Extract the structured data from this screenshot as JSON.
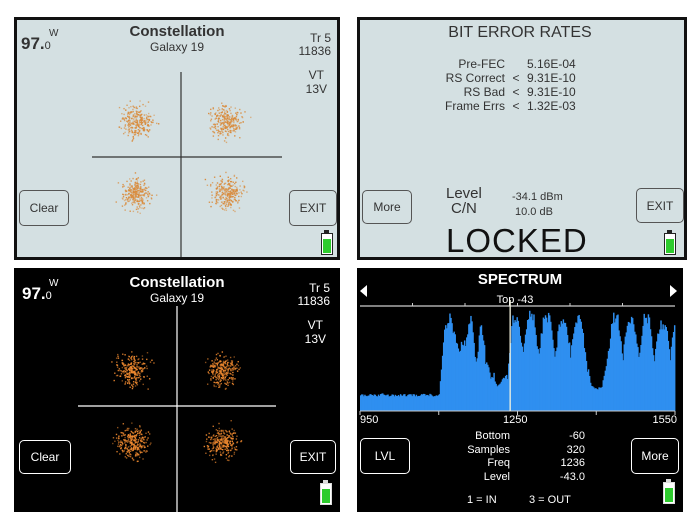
{
  "constellation_light": {
    "title": "Constellation",
    "satellite": "Galaxy 19",
    "position": "97.",
    "position_decimal": "0",
    "direction": "W",
    "transponder": "Tr 5",
    "frequency": "11836",
    "polarity": "VT",
    "voltage": "13V",
    "clear_label": "Clear",
    "exit_label": "EXIT"
  },
  "ber": {
    "title": "BIT ERROR RATES",
    "rows": [
      {
        "label": "Pre-FEC",
        "cmp": "",
        "value": "5.16E-04"
      },
      {
        "label": "RS Correct",
        "cmp": "<",
        "value": "9.31E-10"
      },
      {
        "label": "RS Bad",
        "cmp": "<",
        "value": "9.31E-10"
      },
      {
        "label": "Frame Errs",
        "cmp": "<",
        "value": "1.32E-03"
      }
    ],
    "level_label": "Level",
    "level_value": "-34.1 dBm",
    "cn_label": "C/N",
    "cn_value": "10.0 dB",
    "status": "LOCKED",
    "more_label": "More",
    "exit_label": "EXIT"
  },
  "constellation_dark": {
    "title": "Constellation",
    "satellite": "Galaxy 19",
    "position": "97.",
    "position_decimal": "0",
    "direction": "W",
    "transponder": "Tr 5",
    "frequency": "11836",
    "polarity": "VT",
    "voltage": "13V",
    "clear_label": "Clear",
    "exit_label": "EXIT"
  },
  "spectrum": {
    "title": "SPECTRUM",
    "top_label": "Top -43",
    "x_labels": [
      "950",
      "1250",
      "1550"
    ],
    "stats": [
      {
        "label": "Bottom",
        "value": "-60"
      },
      {
        "label": "Samples",
        "value": "320"
      },
      {
        "label": "Freq",
        "value": "1236"
      },
      {
        "label": "Level",
        "value": "-43.0"
      }
    ],
    "lvl_label": "LVL",
    "more_label": "More",
    "footer_in": "1 = IN",
    "footer_out": "3 = OUT",
    "trace_color": "#2f8ff0"
  },
  "chart_data": {
    "type": "area",
    "x_start": 950,
    "x_step": 10,
    "x_range": [
      950,
      1550
    ],
    "y_range": [
      -60,
      -43
    ],
    "cursor_freq": 1236,
    "levels": [
      -57.5,
      -57.5,
      -57.4,
      -57.5,
      -57.3,
      -57.5,
      -57.4,
      -57.5,
      -57.4,
      -57.5,
      -57.4,
      -57.5,
      -57.3,
      -57.4,
      -57.5,
      -57.4,
      -47,
      -45,
      -48,
      -50,
      -49,
      -44,
      -52,
      -46,
      -53,
      -54,
      -56,
      -55,
      -54,
      -45,
      -45,
      -50,
      -44.5,
      -45,
      -51,
      -44.5,
      -45,
      -51,
      -45.5,
      -45,
      -51,
      -45,
      -45,
      -52,
      -56,
      -56.5,
      -56,
      -52,
      -45,
      -45,
      -51,
      -45,
      -45,
      -51,
      -45,
      -45,
      -52,
      -46,
      -46,
      -51,
      -45
    ]
  }
}
